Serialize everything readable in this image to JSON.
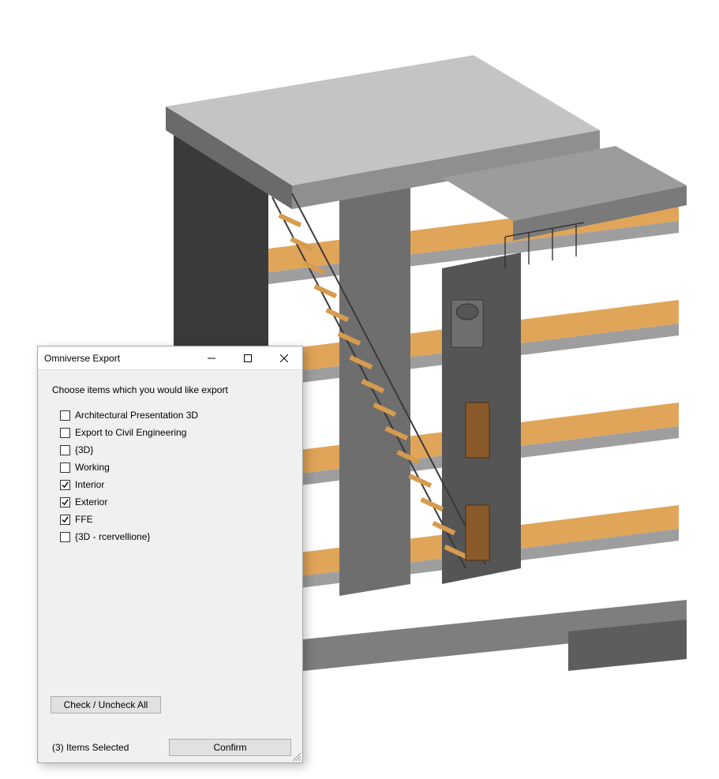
{
  "dialog": {
    "title": "Omniverse Export",
    "instruction": "Choose items which you would like export",
    "items": [
      {
        "label": "Architectural Presentation 3D",
        "checked": false
      },
      {
        "label": "Export to Civil Engineering",
        "checked": false
      },
      {
        "label": "{3D}",
        "checked": false
      },
      {
        "label": "Working",
        "checked": false
      },
      {
        "label": "Interior",
        "checked": true
      },
      {
        "label": "Exterior",
        "checked": true
      },
      {
        "label": "FFE",
        "checked": true
      },
      {
        "label": "{3D - rcervellione}",
        "checked": false
      }
    ],
    "check_all_label": "Check / Uncheck All",
    "selected_count_text": "(3) Items Selected",
    "confirm_label": "Confirm"
  },
  "viewport": {
    "description": "Isometric 3D section cut of multi-story building model"
  }
}
